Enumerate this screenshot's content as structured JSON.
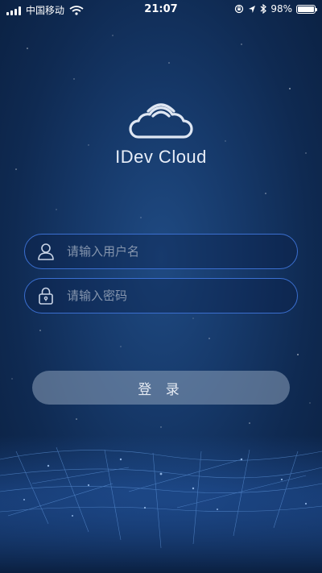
{
  "status_bar": {
    "carrier": "中国移动",
    "time": "21:07",
    "battery_percent_label": "98%",
    "battery_level": 0.98,
    "icons": [
      "signal-icon",
      "wifi-icon",
      "lock-rotation-icon",
      "location-icon",
      "bluetooth-icon",
      "battery-icon"
    ]
  },
  "app": {
    "title": "IDev Cloud",
    "logo_icon": "cloud-wifi-icon"
  },
  "login_form": {
    "username_placeholder": "请输入用户名",
    "password_placeholder": "请输入密码",
    "username_icon": "user-icon",
    "password_icon": "lock-icon",
    "submit_label": "登 录"
  },
  "colors": {
    "background": "#16396a",
    "field_border": "#3b6fd0",
    "button_bg": "#8ca0b9"
  }
}
